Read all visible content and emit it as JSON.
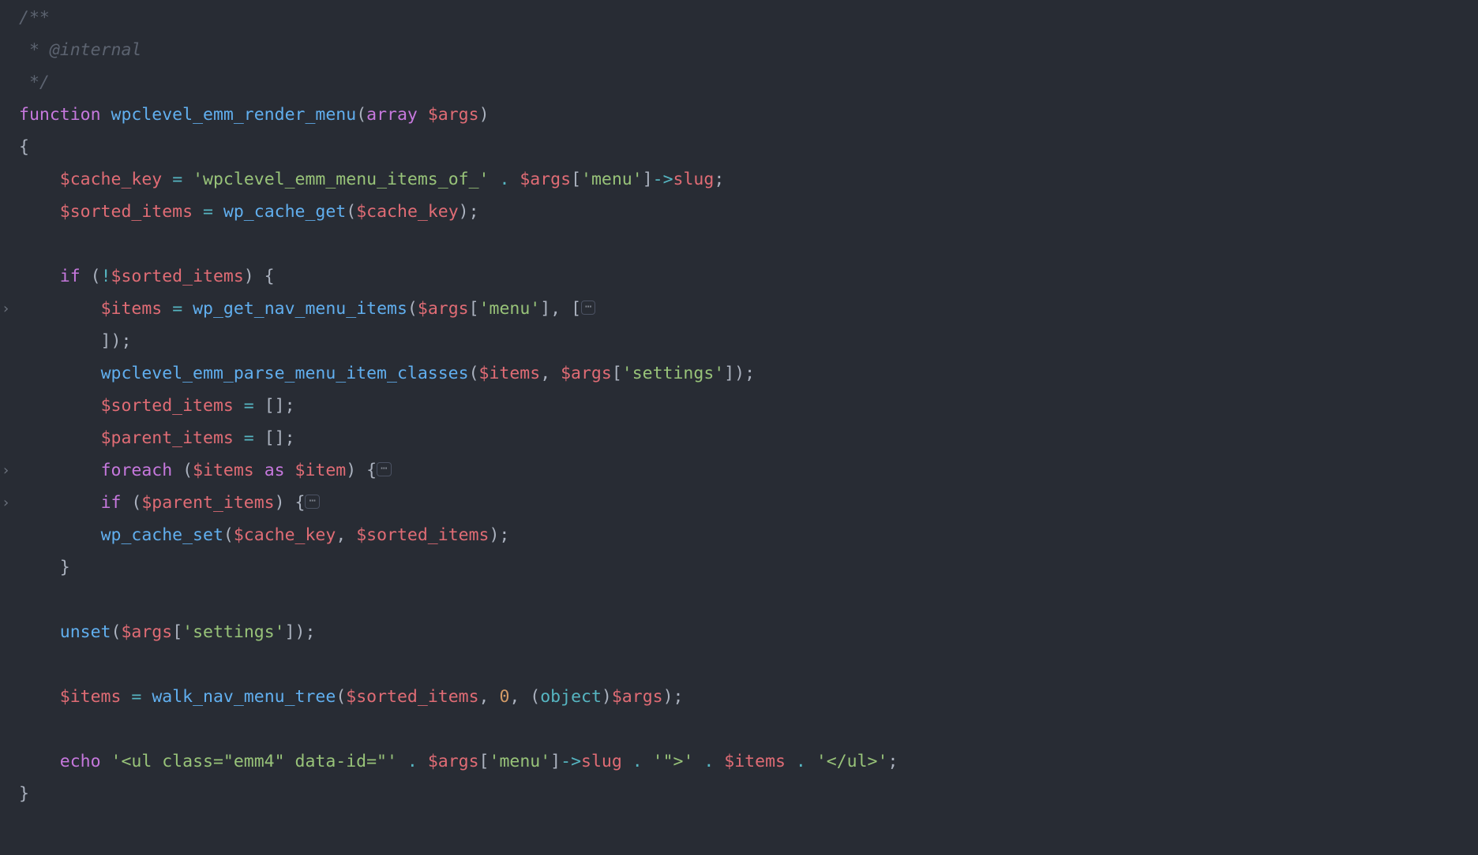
{
  "lines": [
    {
      "gutter": "",
      "segments": [
        {
          "cls": "c-comment",
          "t": "/**"
        }
      ]
    },
    {
      "gutter": "",
      "segments": [
        {
          "cls": "c-comment",
          "t": " * "
        },
        {
          "cls": "c-comment",
          "t": "@internal"
        }
      ]
    },
    {
      "gutter": "",
      "segments": [
        {
          "cls": "c-comment",
          "t": " */"
        }
      ]
    },
    {
      "gutter": "",
      "segments": [
        {
          "cls": "c-kw",
          "t": "function"
        },
        {
          "cls": "c-text",
          "t": " "
        },
        {
          "cls": "c-fn",
          "t": "wpclevel_emm_render_menu"
        },
        {
          "cls": "c-text",
          "t": "("
        },
        {
          "cls": "c-type",
          "t": "array"
        },
        {
          "cls": "c-text",
          "t": " "
        },
        {
          "cls": "c-var",
          "t": "$args"
        },
        {
          "cls": "c-text",
          "t": ")"
        }
      ]
    },
    {
      "gutter": "",
      "segments": [
        {
          "cls": "c-text",
          "t": "{"
        }
      ]
    },
    {
      "gutter": "",
      "segments": [
        {
          "cls": "c-text",
          "t": "    "
        },
        {
          "cls": "c-var",
          "t": "$cache_key"
        },
        {
          "cls": "c-text",
          "t": " "
        },
        {
          "cls": "c-op",
          "t": "="
        },
        {
          "cls": "c-text",
          "t": " "
        },
        {
          "cls": "c-str",
          "t": "'wpclevel_emm_menu_items_of_'"
        },
        {
          "cls": "c-text",
          "t": " "
        },
        {
          "cls": "c-op",
          "t": "."
        },
        {
          "cls": "c-text",
          "t": " "
        },
        {
          "cls": "c-var",
          "t": "$args"
        },
        {
          "cls": "c-text",
          "t": "["
        },
        {
          "cls": "c-str",
          "t": "'menu'"
        },
        {
          "cls": "c-text",
          "t": "]"
        },
        {
          "cls": "c-op",
          "t": "->"
        },
        {
          "cls": "c-var",
          "t": "slug"
        },
        {
          "cls": "c-text",
          "t": ";"
        }
      ]
    },
    {
      "gutter": "",
      "segments": [
        {
          "cls": "c-text",
          "t": "    "
        },
        {
          "cls": "c-var",
          "t": "$sorted_items"
        },
        {
          "cls": "c-text",
          "t": " "
        },
        {
          "cls": "c-op",
          "t": "="
        },
        {
          "cls": "c-text",
          "t": " "
        },
        {
          "cls": "c-fn",
          "t": "wp_cache_get"
        },
        {
          "cls": "c-text",
          "t": "("
        },
        {
          "cls": "c-var",
          "t": "$cache_key"
        },
        {
          "cls": "c-text",
          "t": ");"
        }
      ]
    },
    {
      "gutter": "",
      "segments": [
        {
          "cls": "c-text",
          "t": ""
        }
      ]
    },
    {
      "gutter": "",
      "segments": [
        {
          "cls": "c-text",
          "t": "    "
        },
        {
          "cls": "c-kw",
          "t": "if"
        },
        {
          "cls": "c-text",
          "t": " ("
        },
        {
          "cls": "c-op",
          "t": "!"
        },
        {
          "cls": "c-var",
          "t": "$sorted_items"
        },
        {
          "cls": "c-text",
          "t": ") {"
        }
      ]
    },
    {
      "gutter": ">",
      "fold": true,
      "segments": [
        {
          "cls": "c-text",
          "t": "        "
        },
        {
          "cls": "c-var",
          "t": "$items"
        },
        {
          "cls": "c-text",
          "t": " "
        },
        {
          "cls": "c-op",
          "t": "="
        },
        {
          "cls": "c-text",
          "t": " "
        },
        {
          "cls": "c-fn",
          "t": "wp_get_nav_menu_items"
        },
        {
          "cls": "c-text",
          "t": "("
        },
        {
          "cls": "c-var",
          "t": "$args"
        },
        {
          "cls": "c-text",
          "t": "["
        },
        {
          "cls": "c-str",
          "t": "'menu'"
        },
        {
          "cls": "c-text",
          "t": "], ["
        },
        {
          "cls": "fold",
          "t": "⋯"
        }
      ]
    },
    {
      "gutter": "",
      "segments": [
        {
          "cls": "c-text",
          "t": "        ]);"
        }
      ]
    },
    {
      "gutter": "",
      "segments": [
        {
          "cls": "c-text",
          "t": "        "
        },
        {
          "cls": "c-fn",
          "t": "wpclevel_emm_parse_menu_item_classes"
        },
        {
          "cls": "c-text",
          "t": "("
        },
        {
          "cls": "c-var",
          "t": "$items"
        },
        {
          "cls": "c-text",
          "t": ", "
        },
        {
          "cls": "c-var",
          "t": "$args"
        },
        {
          "cls": "c-text",
          "t": "["
        },
        {
          "cls": "c-str",
          "t": "'settings'"
        },
        {
          "cls": "c-text",
          "t": "]);"
        }
      ]
    },
    {
      "gutter": "",
      "segments": [
        {
          "cls": "c-text",
          "t": "        "
        },
        {
          "cls": "c-var",
          "t": "$sorted_items"
        },
        {
          "cls": "c-text",
          "t": " "
        },
        {
          "cls": "c-op",
          "t": "="
        },
        {
          "cls": "c-text",
          "t": " [];"
        }
      ]
    },
    {
      "gutter": "",
      "segments": [
        {
          "cls": "c-text",
          "t": "        "
        },
        {
          "cls": "c-var",
          "t": "$parent_items"
        },
        {
          "cls": "c-text",
          "t": " "
        },
        {
          "cls": "c-op",
          "t": "="
        },
        {
          "cls": "c-text",
          "t": " [];"
        }
      ]
    },
    {
      "gutter": ">",
      "fold": true,
      "segments": [
        {
          "cls": "c-text",
          "t": "        "
        },
        {
          "cls": "c-kw",
          "t": "foreach"
        },
        {
          "cls": "c-text",
          "t": " ("
        },
        {
          "cls": "c-var",
          "t": "$items"
        },
        {
          "cls": "c-text",
          "t": " "
        },
        {
          "cls": "c-kw",
          "t": "as"
        },
        {
          "cls": "c-text",
          "t": " "
        },
        {
          "cls": "c-var",
          "t": "$item"
        },
        {
          "cls": "c-text",
          "t": ") {"
        },
        {
          "cls": "fold",
          "t": "⋯"
        }
      ]
    },
    {
      "gutter": ">",
      "fold": true,
      "segments": [
        {
          "cls": "c-text",
          "t": "        "
        },
        {
          "cls": "c-kw",
          "t": "if"
        },
        {
          "cls": "c-text",
          "t": " ("
        },
        {
          "cls": "c-var",
          "t": "$parent_items"
        },
        {
          "cls": "c-text",
          "t": ") {"
        },
        {
          "cls": "fold",
          "t": "⋯"
        }
      ]
    },
    {
      "gutter": "",
      "segments": [
        {
          "cls": "c-text",
          "t": "        "
        },
        {
          "cls": "c-fn",
          "t": "wp_cache_set"
        },
        {
          "cls": "c-text",
          "t": "("
        },
        {
          "cls": "c-var",
          "t": "$cache_key"
        },
        {
          "cls": "c-text",
          "t": ", "
        },
        {
          "cls": "c-var",
          "t": "$sorted_items"
        },
        {
          "cls": "c-text",
          "t": ");"
        }
      ]
    },
    {
      "gutter": "",
      "segments": [
        {
          "cls": "c-text",
          "t": "    }"
        }
      ]
    },
    {
      "gutter": "",
      "segments": [
        {
          "cls": "c-text",
          "t": ""
        }
      ]
    },
    {
      "gutter": "",
      "segments": [
        {
          "cls": "c-text",
          "t": "    "
        },
        {
          "cls": "c-fn",
          "t": "unset"
        },
        {
          "cls": "c-text",
          "t": "("
        },
        {
          "cls": "c-var",
          "t": "$args"
        },
        {
          "cls": "c-text",
          "t": "["
        },
        {
          "cls": "c-str",
          "t": "'settings'"
        },
        {
          "cls": "c-text",
          "t": "]);"
        }
      ]
    },
    {
      "gutter": "",
      "segments": [
        {
          "cls": "c-text",
          "t": ""
        }
      ]
    },
    {
      "gutter": "",
      "segments": [
        {
          "cls": "c-text",
          "t": "    "
        },
        {
          "cls": "c-var",
          "t": "$items"
        },
        {
          "cls": "c-text",
          "t": " "
        },
        {
          "cls": "c-op",
          "t": "="
        },
        {
          "cls": "c-text",
          "t": " "
        },
        {
          "cls": "c-fn",
          "t": "walk_nav_menu_tree"
        },
        {
          "cls": "c-text",
          "t": "("
        },
        {
          "cls": "c-var",
          "t": "$sorted_items"
        },
        {
          "cls": "c-text",
          "t": ", "
        },
        {
          "cls": "c-num",
          "t": "0"
        },
        {
          "cls": "c-text",
          "t": ", ("
        },
        {
          "cls": "c-obj",
          "t": "object"
        },
        {
          "cls": "c-text",
          "t": ")"
        },
        {
          "cls": "c-var",
          "t": "$args"
        },
        {
          "cls": "c-text",
          "t": ");"
        }
      ]
    },
    {
      "gutter": "",
      "segments": [
        {
          "cls": "c-text",
          "t": ""
        }
      ]
    },
    {
      "gutter": "",
      "segments": [
        {
          "cls": "c-text",
          "t": "    "
        },
        {
          "cls": "c-kw",
          "t": "echo"
        },
        {
          "cls": "c-text",
          "t": " "
        },
        {
          "cls": "c-str",
          "t": "'<ul class=\"emm4\" data-id=\"'"
        },
        {
          "cls": "c-text",
          "t": " "
        },
        {
          "cls": "c-op",
          "t": "."
        },
        {
          "cls": "c-text",
          "t": " "
        },
        {
          "cls": "c-var",
          "t": "$args"
        },
        {
          "cls": "c-text",
          "t": "["
        },
        {
          "cls": "c-str",
          "t": "'menu'"
        },
        {
          "cls": "c-text",
          "t": "]"
        },
        {
          "cls": "c-op",
          "t": "->"
        },
        {
          "cls": "c-var",
          "t": "slug"
        },
        {
          "cls": "c-text",
          "t": " "
        },
        {
          "cls": "c-op",
          "t": "."
        },
        {
          "cls": "c-text",
          "t": " "
        },
        {
          "cls": "c-str",
          "t": "'\">'"
        },
        {
          "cls": "c-text",
          "t": " "
        },
        {
          "cls": "c-op",
          "t": "."
        },
        {
          "cls": "c-text",
          "t": " "
        },
        {
          "cls": "c-var",
          "t": "$items"
        },
        {
          "cls": "c-text",
          "t": " "
        },
        {
          "cls": "c-op",
          "t": "."
        },
        {
          "cls": "c-text",
          "t": " "
        },
        {
          "cls": "c-str",
          "t": "'</ul>'"
        },
        {
          "cls": "c-text",
          "t": ";"
        }
      ]
    },
    {
      "gutter": "",
      "segments": [
        {
          "cls": "c-text",
          "t": "}"
        }
      ]
    }
  ]
}
